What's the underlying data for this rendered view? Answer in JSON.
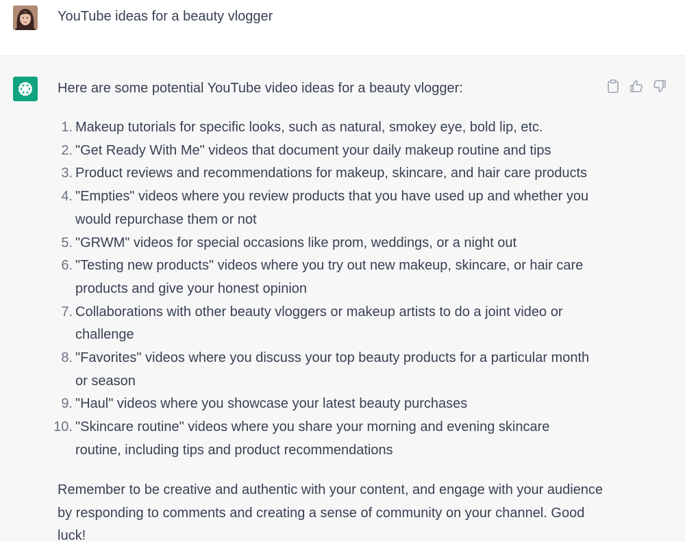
{
  "user_message": {
    "text": "YouTube ideas for a beauty vlogger"
  },
  "assistant_message": {
    "intro": "Here are some potential YouTube video ideas for a beauty vlogger:",
    "items": [
      {
        "num": "1.",
        "text": "Makeup tutorials for specific looks, such as natural, smokey eye, bold lip, etc."
      },
      {
        "num": "2.",
        "text": "\"Get Ready With Me\" videos that document your daily makeup routine and tips"
      },
      {
        "num": "3.",
        "text": "Product reviews and recommendations for makeup, skincare, and hair care products"
      },
      {
        "num": "4.",
        "text": "\"Empties\" videos where you review products that you have used up and whether you would repurchase them or not"
      },
      {
        "num": "5.",
        "text": "\"GRWM\" videos for special occasions like prom, weddings, or a night out"
      },
      {
        "num": "6.",
        "text": "\"Testing new products\" videos where you try out new makeup, skincare, or hair care products and give your honest opinion"
      },
      {
        "num": "7.",
        "text": "Collaborations with other beauty vloggers or makeup artists to do a joint video or challenge"
      },
      {
        "num": "8.",
        "text": "\"Favorites\" videos where you discuss your top beauty products for a particular month or season"
      },
      {
        "num": "9.",
        "text": "\"Haul\" videos where you showcase your latest beauty purchases"
      },
      {
        "num": "10.",
        "text": "\"Skincare routine\" videos where you share your morning and evening skincare routine, including tips and product recommendations"
      }
    ],
    "closing": "Remember to be creative and authentic with your content, and engage with your audience by responding to comments and creating a sense of community on your channel. Good luck!"
  },
  "icons": {
    "user_avatar": "user-avatar",
    "assistant_logo": "openai-logo-icon",
    "copy": "clipboard-icon",
    "like": "thumbs-up-icon",
    "dislike": "thumbs-down-icon"
  },
  "colors": {
    "assistant_bg": "#f7f7f8",
    "logo_bg": "#10a37f",
    "text": "#374151"
  }
}
